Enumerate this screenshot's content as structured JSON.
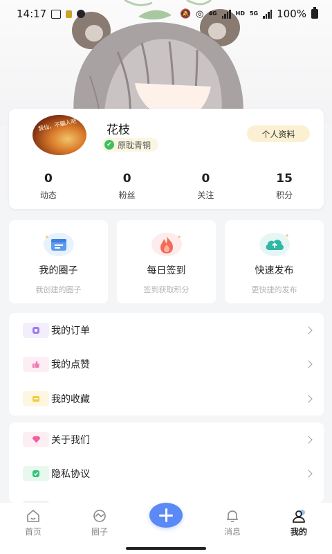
{
  "status_bar": {
    "time": "14:17",
    "network_small": "4G",
    "hd_small": "HD",
    "network_small_2": "5G",
    "battery_text": "100%"
  },
  "profile": {
    "avatar_text": "我仙，不騙人吧",
    "name": "花枝",
    "level": "原耽青铜",
    "edit_button": "个人资料",
    "stats": [
      {
        "value": "0",
        "label": "动态"
      },
      {
        "value": "0",
        "label": "粉丝"
      },
      {
        "value": "0",
        "label": "关注"
      },
      {
        "value": "15",
        "label": "积分"
      }
    ]
  },
  "features": [
    {
      "title": "我的圈子",
      "subtitle": "我创建的圈子",
      "icon": "circle-calendar-icon"
    },
    {
      "title": "每日签到",
      "subtitle": "签到获取积分",
      "icon": "fire-icon"
    },
    {
      "title": "快速发布",
      "subtitle": "更快捷的发布",
      "icon": "cloud-upload-icon"
    }
  ],
  "menu_group_1": [
    {
      "label": "我的订单",
      "icon": "order-icon",
      "color": "#9b7bf0"
    },
    {
      "label": "我的点赞",
      "icon": "thumb-up-icon",
      "color": "#f07ab0"
    },
    {
      "label": "我的收藏",
      "icon": "favorite-icon",
      "color": "#f5c93a"
    }
  ],
  "menu_group_2": [
    {
      "label": "关于我们",
      "icon": "diamond-icon",
      "color": "#f0609c"
    },
    {
      "label": "隐私协议",
      "icon": "shield-check-icon",
      "color": "#34c47a"
    }
  ],
  "bottom_nav": [
    {
      "label": "首页",
      "icon": "home-icon",
      "active": false
    },
    {
      "label": "圈子",
      "icon": "circle-icon",
      "active": false
    },
    {
      "label": "",
      "icon": "add-icon",
      "active": false
    },
    {
      "label": "消息",
      "icon": "bell-icon",
      "active": false
    },
    {
      "label": "我的",
      "icon": "user-icon",
      "active": true
    }
  ],
  "colors": {
    "accent": "#5b89f5",
    "badge_bg": "#fbf6e2",
    "button_bg": "#fbf1d2",
    "page_bg": "#f4f5f7"
  }
}
